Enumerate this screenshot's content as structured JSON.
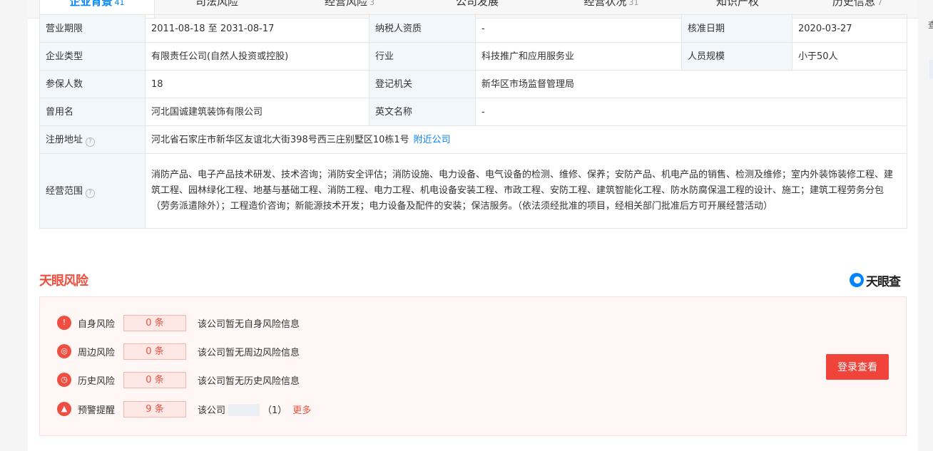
{
  "tabs": [
    {
      "label": "企业背景",
      "count": "41",
      "active": true
    },
    {
      "label": "司法风险",
      "count": "",
      "active": false
    },
    {
      "label": "经营风险",
      "count": "3",
      "active": false
    },
    {
      "label": "公司发展",
      "count": "",
      "active": false
    },
    {
      "label": "经营状况",
      "count": "31",
      "active": false
    },
    {
      "label": "知识产权",
      "count": "",
      "active": false
    },
    {
      "label": "历史信息",
      "count": "7",
      "active": false
    }
  ],
  "info": {
    "business_term": {
      "label": "营业期限",
      "value": "2011-08-18 至 2031-08-17"
    },
    "taxpayer": {
      "label": "纳税人资质",
      "value": "-"
    },
    "approval_date": {
      "label": "核准日期",
      "value": "2020-03-27"
    },
    "company_type": {
      "label": "企业类型",
      "value": "有限责任公司(自然人投资或控股)"
    },
    "industry": {
      "label": "行业",
      "value": "科技推广和应用服务业"
    },
    "staff_size": {
      "label": "人员规模",
      "value": "小于50人"
    },
    "insured": {
      "label": "参保人数",
      "value": "18"
    },
    "registration_authority": {
      "label": "登记机关",
      "value": "新华区市场监督管理局"
    },
    "former_name": {
      "label": "曾用名",
      "value": "河北国诚建筑装饰有限公司"
    },
    "english_name": {
      "label": "英文名称",
      "value": "-"
    },
    "address": {
      "label": "注册地址",
      "value": "河北省石家庄市新华区友谊北大街398号西三庄别墅区10栋1号",
      "link": "附近公司"
    },
    "scope": {
      "label": "经营范围",
      "value": "消防产品、电子产品技术研发、技术咨询；消防安全评估；消防设施、电力设备、电气设备的检测、维修、保养；安防产品、机电产品的销售、检测及维修；室内外装饰装修工程、建筑工程、园林绿化工程、地基与基础工程、消防工程、电力工程、机电设备安装工程、市政工程、安防工程、建筑智能化工程、防水防腐保温工程的设计、施工；建筑工程劳务分包（劳务派遣除外）；工程造价咨询；新能源技术开发；电力设备及配件的安装；保洁服务。（依法须经批准的项目，经相关部门批准后方可开展经营活动）"
    }
  },
  "risk": {
    "title": "天眼风险",
    "brand": "天眼查",
    "rows": [
      {
        "label": "自身风险",
        "count": "0 条",
        "desc": "该公司暂无自身风险信息"
      },
      {
        "label": "周边风险",
        "count": "0 条",
        "desc": "该公司暂无周边风险信息"
      },
      {
        "label": "历史风险",
        "count": "0 条",
        "desc": "该公司暂无历史风险信息"
      },
      {
        "label": "预警提醒",
        "count": "9 条",
        "desc": "该公司",
        "suffix": "（1）",
        "more": "更多"
      }
    ],
    "login_button": "登录查看"
  },
  "edge_char": "查"
}
